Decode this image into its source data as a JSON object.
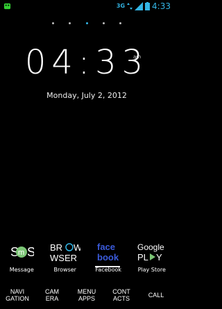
{
  "statusbar": {
    "left_icon": "android-icon",
    "network_type": "3G",
    "time": "4:33"
  },
  "clock": {
    "time": "04:33",
    "ampm": "am",
    "date": "Monday,  July 2,  2012"
  },
  "apps": [
    {
      "name": "sms-icon",
      "label": "Message"
    },
    {
      "name": "browser-icon",
      "label": "Browser"
    },
    {
      "name": "facebook-icon",
      "label": "Facebook"
    },
    {
      "name": "google-play-icon",
      "label": "Play Store"
    }
  ],
  "hotseat": [
    {
      "name": "navigation",
      "line1": "NAVI",
      "line2": "GATION"
    },
    {
      "name": "camera",
      "line1": "CAM",
      "line2": "ERA"
    },
    {
      "name": "menu-apps",
      "line1": "MENU",
      "line2": "APPS"
    },
    {
      "name": "contacts",
      "line1": "CONT",
      "line2": "ACTS"
    },
    {
      "name": "call",
      "line1": "CALL",
      "line2": ""
    }
  ],
  "colors": {
    "accent": "#33b5e5",
    "background": "#000000"
  }
}
